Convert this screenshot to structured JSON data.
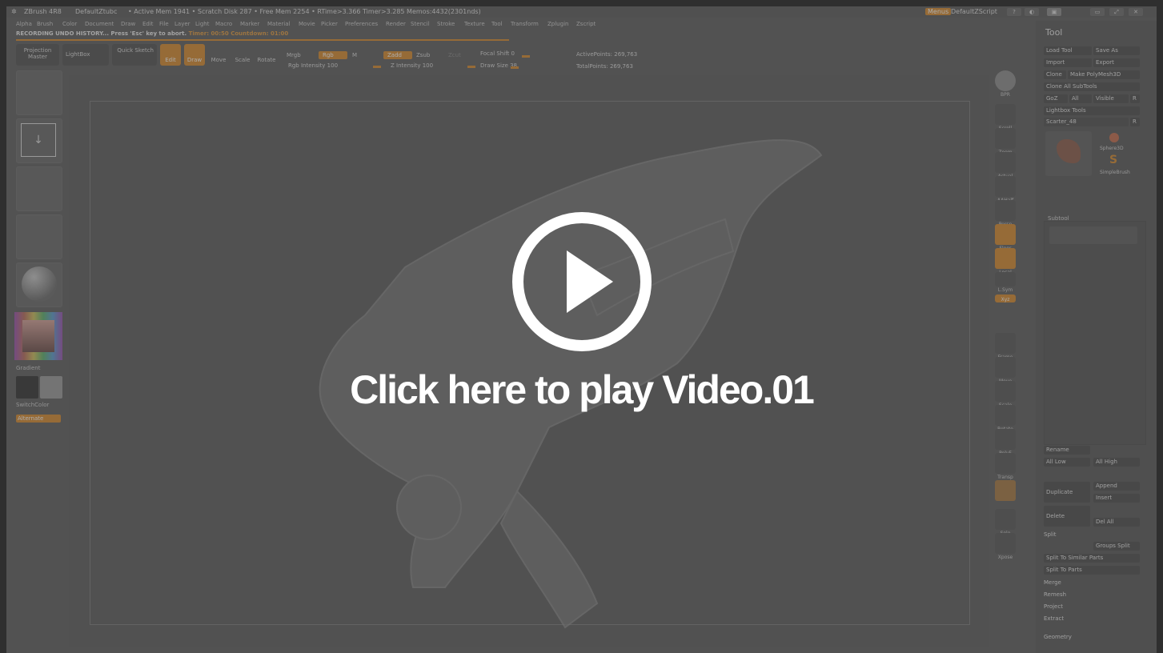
{
  "titlebar": {
    "app": "ZBrush 4R8",
    "doc": "DefaultZtubc",
    "stats": "• Active Mem 1941 • Scratch Disk 287 • Free Mem 2254 • RTime>3.366 Timer>3.285 Memos:4432(2301nds)",
    "menus_label": "Menus",
    "script_label": "DefaultZScript",
    "controls": [
      "?",
      "◐",
      "▣",
      "▭",
      "⤢",
      "✕"
    ]
  },
  "menubar": {
    "items": [
      "Alpha",
      "Brush",
      "Color",
      "Document",
      "Draw",
      "Edit",
      "File",
      "Layer",
      "Light",
      "Macro",
      "Marker",
      "Material",
      "Movie",
      "Picker",
      "Preferences",
      "Render",
      "Stencil",
      "Stroke",
      "Texture",
      "Tool",
      "Transform",
      "Zplugin",
      "Zscript"
    ]
  },
  "status": {
    "message": "RECORDING UNDO HISTORY... Press 'Esc' key to abort.",
    "timer_label": "Timer: 00:50",
    "countdown_label": "Countdown: 01:00"
  },
  "toolbar": {
    "projection_master": "Projection Master",
    "lightbox": "LightBox",
    "quick_sketch": "Quick Sketch",
    "edit": "Edit",
    "draw": "Draw",
    "move": "Move",
    "scale": "Scale",
    "rotate": "Rotate",
    "mrgb": "Mrgb",
    "rgb": "Rgb",
    "m": "M",
    "rgb_intensity": "Rgb Intensity 100",
    "zadd": "Zadd",
    "zsub": "Zsub",
    "zcut": "Zcut",
    "z_intensity": "Z Intensity 100",
    "focal_shift": "Focal Shift 0",
    "draw_size": "Draw Size 38",
    "active_points": "ActivePoints: 269,763",
    "total_points": "TotalPoints: 269,763"
  },
  "left_shelf": {
    "gradient": "Gradient",
    "switch_color": "SwitchColor",
    "alternate": "Alternate"
  },
  "right_shelf": {
    "items": [
      {
        "name": "bpr",
        "label": "BPR"
      },
      {
        "name": "scroll",
        "label": "Scroll"
      },
      {
        "name": "zoom",
        "label": "Zoom"
      },
      {
        "name": "actual",
        "label": "Actual"
      },
      {
        "name": "aahalf",
        "label": "AAHalf"
      },
      {
        "name": "persp",
        "label": "Persp"
      },
      {
        "name": "floor",
        "label": "Floor"
      },
      {
        "name": "local",
        "label": "Local"
      },
      {
        "name": "lsym",
        "label": "L.Sym"
      },
      {
        "name": "xyz",
        "label": "Xyz"
      },
      {
        "name": "frame",
        "label": "Frame"
      },
      {
        "name": "move",
        "label": "Move"
      },
      {
        "name": "scale",
        "label": "Scale"
      },
      {
        "name": "rotate",
        "label": "Rotate"
      },
      {
        "name": "polyf",
        "label": "PolyF"
      },
      {
        "name": "transp",
        "label": "Transp"
      },
      {
        "name": "solo",
        "label": "Solo"
      },
      {
        "name": "xpose",
        "label": "Xpose"
      }
    ]
  },
  "tool_palette": {
    "title": "Tool",
    "load_tool": "Load Tool",
    "save_as": "Save As",
    "import": "Import",
    "export": "Export",
    "clone": "Clone",
    "make_polymesh": "Make PolyMesh3D",
    "clone_all": "Clone All SubTools",
    "goz": "GoZ",
    "all": "All",
    "visible": "Visible",
    "r": "R",
    "lightbox_tools": "Lightbox Tools",
    "current_tool": "Scarter_48",
    "sphere3d": "Sphere3D",
    "simplebrush": "SimpleBrush",
    "subtool": "Subtool",
    "rename": "Rename",
    "all_low": "All Low",
    "all_high": "All High",
    "duplicate": "Duplicate",
    "append": "Append",
    "insert": "Insert",
    "delete": "Delete",
    "del_all": "Del All",
    "split": "Split",
    "groups_split": "Groups Split",
    "split_similar": "Split To Similar Parts",
    "split_parts": "Split To Parts",
    "merge": "Merge",
    "remesh": "Remesh",
    "project": "Project",
    "extract": "Extract",
    "geometry": "Geometry"
  },
  "overlay": {
    "play_text": "Click here to play Video.01"
  }
}
